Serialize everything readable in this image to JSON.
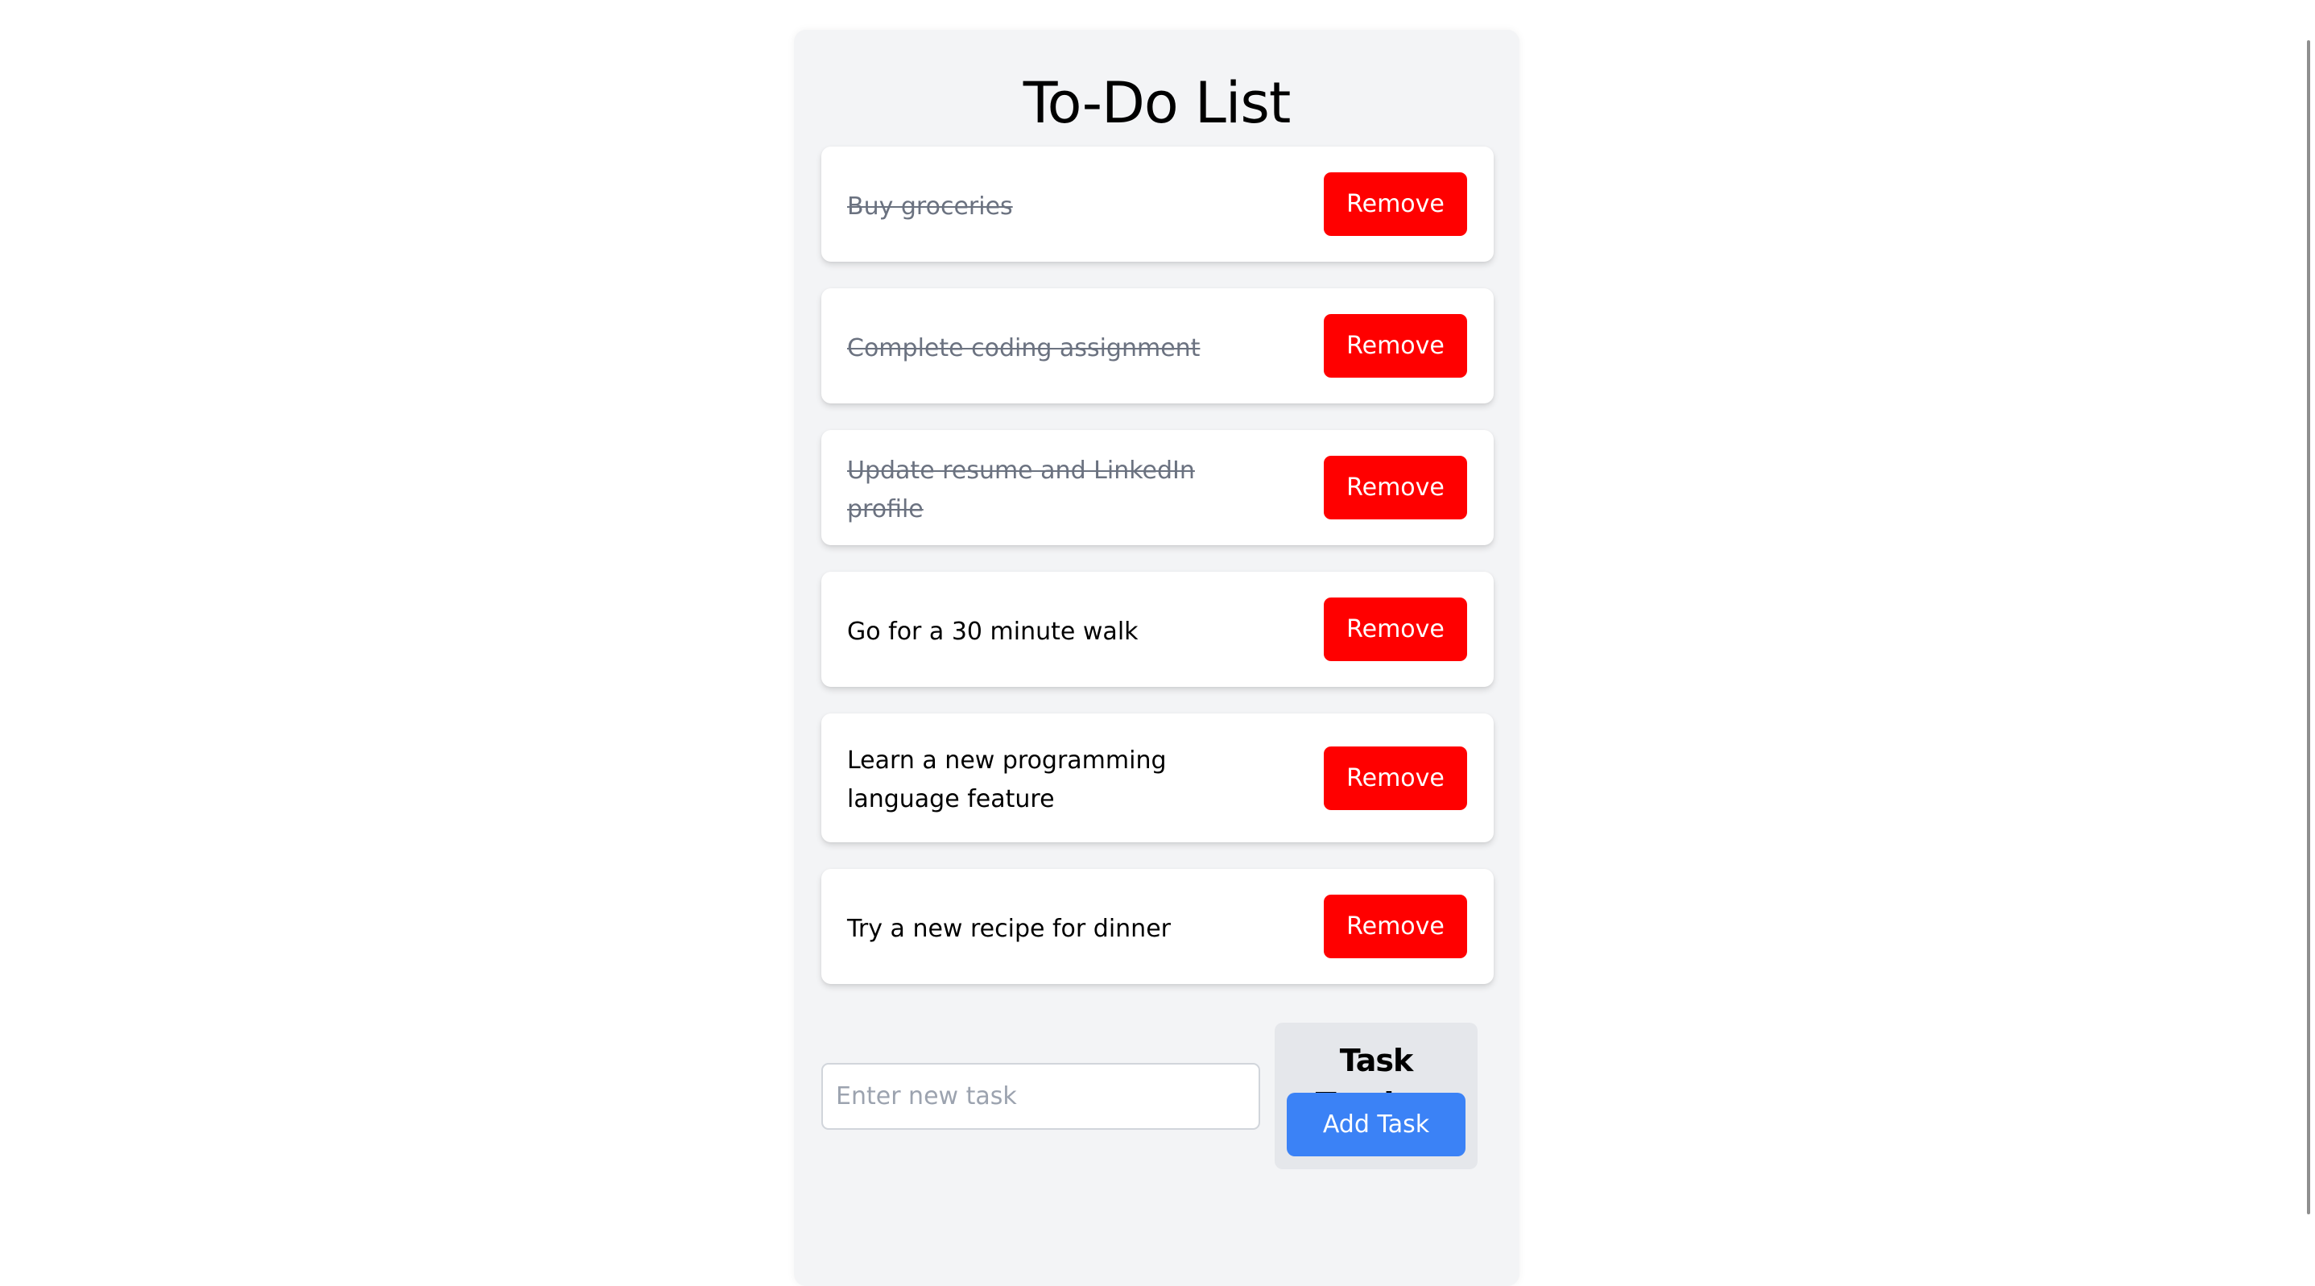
{
  "app": {
    "title": "To-Do List"
  },
  "tasks": [
    {
      "text": "Buy groceries",
      "completed": true,
      "remove_label": "Remove"
    },
    {
      "text": "Complete coding assignment",
      "completed": true,
      "remove_label": "Remove"
    },
    {
      "text": "Update resume and LinkedIn profile",
      "completed": true,
      "remove_label": "Remove"
    },
    {
      "text": "Go for a 30 minute walk",
      "completed": false,
      "remove_label": "Remove"
    },
    {
      "text": "Learn a new programming language feature",
      "completed": false,
      "remove_label": "Remove"
    },
    {
      "text": "Try a new recipe for dinner",
      "completed": false,
      "remove_label": "Remove"
    }
  ],
  "add_task": {
    "input_value": "",
    "input_placeholder": "Enter new task",
    "tracker_title": "Task Tracker",
    "button_label": "Add Task"
  },
  "colors": {
    "remove_button": "#ff0000",
    "add_button": "#3b82f6",
    "completed_text": "#6b7280",
    "container_bg": "#f3f4f6",
    "tracker_bg": "#e5e7eb"
  }
}
